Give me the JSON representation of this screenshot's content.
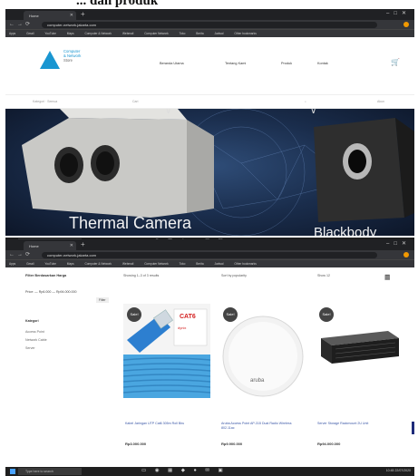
{
  "caption": "... dan produk",
  "browser": {
    "tab_title": "Home",
    "url": "computer-network-jakarta.com",
    "bookmarks": [
      "Apps",
      "Gmail",
      "YouTube",
      "Maps",
      "Computer & Network",
      "Webmail",
      "Computer Network",
      "Toko",
      "Berita",
      "Jadwal",
      "Other bookmarks"
    ]
  },
  "site": {
    "logo_line1": "Computer",
    "logo_line2": "& Network",
    "logo_line3": "Store",
    "nav": [
      "Beranda Utama",
      "Tentang Kami",
      "Produk",
      "Kontak"
    ],
    "search_category": "Kategori · Semua",
    "search_placeholder": "Cari",
    "account_label": "Akun"
  },
  "hero": {
    "left_caption": "Thermal Camera",
    "right_caption": "Blackbody"
  },
  "taskbar": {
    "search_placeholder": "Type here to search",
    "time": "10:45",
    "date": "22/07/2020"
  },
  "shop": {
    "filter_title": "Filter Berdasarkan Harga",
    "price_range": "Price: — Rp6.000 — Rp94.000.000",
    "filter_button": "Filter",
    "categories_heading": "Kategori",
    "categories": [
      "Access Point",
      "Network Cable",
      "Server"
    ],
    "result_count": "Showing 1–3 of 3 results",
    "sort_label": "Sort by popularity",
    "per_page": "Show 12"
  },
  "products": [
    {
      "name": "Kabel Jaringan UTP Cat6 305m Roll Biru",
      "price": "Rp3.000.000",
      "badge": "Sale!",
      "brand": "CAT6"
    },
    {
      "name": "Aruba Access Point AP-315 Dual Radio Wireless 802.11ac",
      "price": "Rp9.900.000",
      "badge": "Sale!",
      "brand": "aruba"
    },
    {
      "name": "Server Storage Rackmount 2U Unit",
      "price": "Rp94.000.000",
      "badge": "Sale!",
      "brand": ""
    }
  ],
  "icons": {
    "cart": "cart-icon",
    "grid": "grid-view-icon",
    "list": "list-view-icon",
    "windows": "windows-logo-icon"
  },
  "colors": {
    "brand_blue": "#1a96d1",
    "product_link": "#3a56a6",
    "cart_button": "#1e2b7a"
  }
}
